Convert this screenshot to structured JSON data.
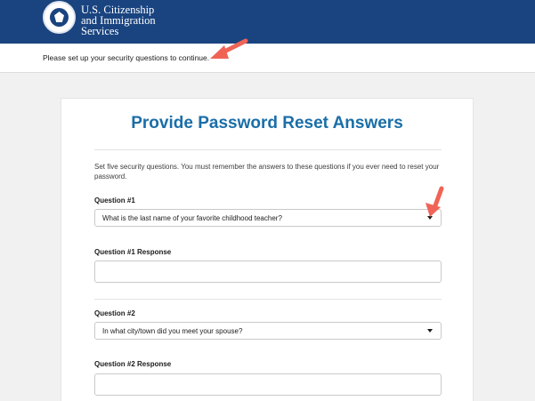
{
  "header": {
    "agency_line1": "U.S. Citizenship",
    "agency_line2": "and Immigration",
    "agency_line3": "Services"
  },
  "notice": {
    "text": "Please set up your security questions to continue."
  },
  "form": {
    "title": "Provide Password Reset Answers",
    "intro": "Set five security questions. You must remember the answers to these questions if you ever need to reset your password.",
    "questions": [
      {
        "label": "Question #1",
        "selected": "What is the last name of your favorite childhood teacher?",
        "response_label": "Question #1 Response",
        "response_value": ""
      },
      {
        "label": "Question #2",
        "selected": "In what city/town did you meet your spouse?",
        "response_label": "Question #2 Response",
        "response_value": ""
      }
    ]
  },
  "colors": {
    "header_bg": "#1a4480",
    "title": "#1a6ea8",
    "annotation_arrow": "#f06456"
  }
}
